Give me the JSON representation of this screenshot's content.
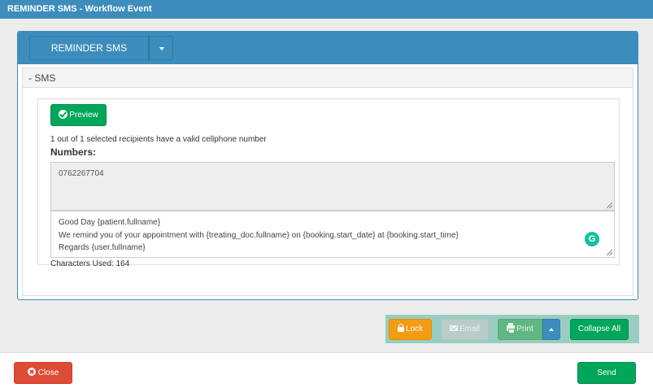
{
  "window": {
    "title": "REMINDER SMS - Workflow Event"
  },
  "header": {
    "dropdown_label": "REMINDER SMS"
  },
  "sms": {
    "section_title": "- SMS",
    "preview_label": "Preview",
    "recipients_info": "1 out of 1 selected recipients have a valid cellphone number",
    "numbers_label": "Numbers:",
    "numbers_value": "0762267704",
    "message_lines": [
      "Good Day {patient.fullname}",
      "We remind you of your  appointment  with {treating_doc.fullname} on {booking.start_date} at {booking.start_time}",
      "Regards {user.fullname}"
    ],
    "characters_used": "Characters Used: 164"
  },
  "actions": {
    "lock": "Lock",
    "email": "Email",
    "print": "Print",
    "collapse_all": "Collapse All"
  },
  "footer": {
    "close": "Close",
    "send": "Send"
  },
  "colors": {
    "primary": "#3c8dbc",
    "success": "#00a65a",
    "warning": "#f39c12",
    "danger": "#dd4b39"
  }
}
